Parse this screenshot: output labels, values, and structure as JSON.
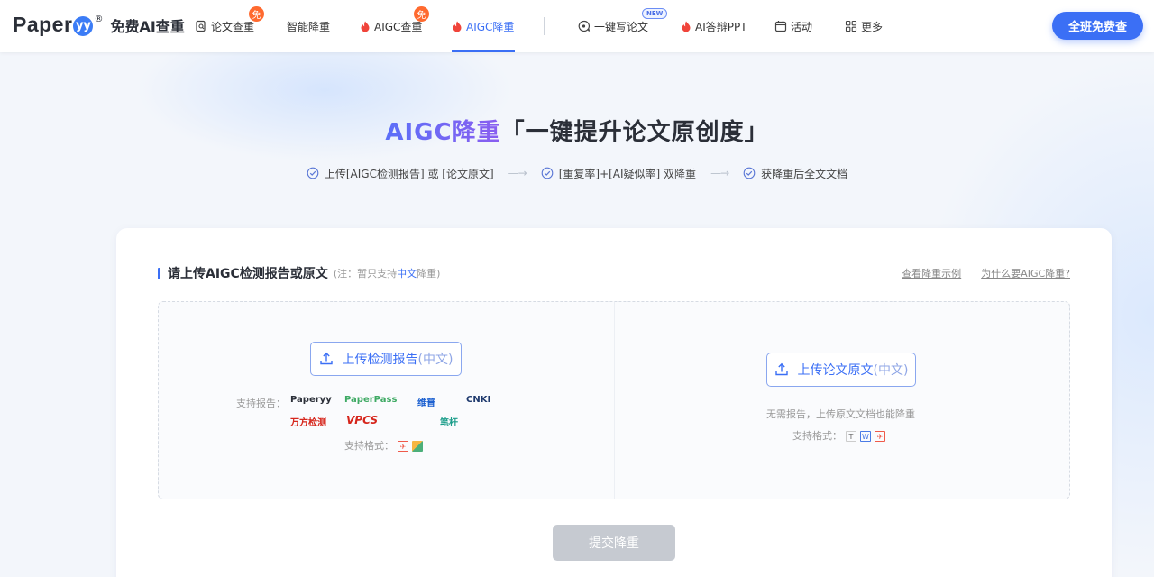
{
  "nav": {
    "logo_word": "Paper",
    "logo_mark": "yy",
    "logo_reg": "®",
    "logo_sub": "免费AI查重",
    "items": [
      {
        "label": "论文查重",
        "badge": "免"
      },
      {
        "label": "智能降重"
      },
      {
        "label": "AIGC查重",
        "badge": "免"
      },
      {
        "label": "AIGC降重"
      },
      {
        "label": "一键写论文",
        "badge": "NEW"
      },
      {
        "label": "AI答辩PPT"
      },
      {
        "label": "活动"
      },
      {
        "label": "更多"
      }
    ],
    "cta": "全班免费查"
  },
  "hero": {
    "title_highlight": "AIGC降重",
    "title_rest": "「一键提升论文原创度」",
    "steps": [
      "上传[AIGC检测报告] 或 [论文原文]",
      "[重复率]+[AI疑似率] 双降重",
      "获降重后全文文档"
    ],
    "arrow": "—→"
  },
  "card": {
    "title": "请上传AIGC检测报告或原文",
    "note_prefix": "(注：暂只支持",
    "note_highlight": "中文",
    "note_suffix": "降重)",
    "link_example": "查看降重示例",
    "link_why": "为什么要AIGC降重?",
    "left": {
      "button_main": "上传检测报告",
      "button_hint": "(中文)",
      "supported_label": "支持报告：",
      "brands": [
        "Paperyy",
        "PaperPass",
        "维普",
        "CNKI",
        "万方检测",
        "VPCS",
        "笔杆"
      ],
      "formats_label": "支持格式：",
      "formats": [
        "PDF",
        "IMG"
      ]
    },
    "right": {
      "button_main": "上传论文原文",
      "button_hint": "(中文)",
      "desc": "无需报告，上传原文文档也能降重",
      "formats_label": "支持格式：",
      "formats": [
        "T",
        "W",
        "PDF"
      ]
    },
    "submit": "提交降重"
  },
  "colors": {
    "accent": "#3b6ff5",
    "badge": "#ff6a2f",
    "disabled": "#c6cad1"
  }
}
